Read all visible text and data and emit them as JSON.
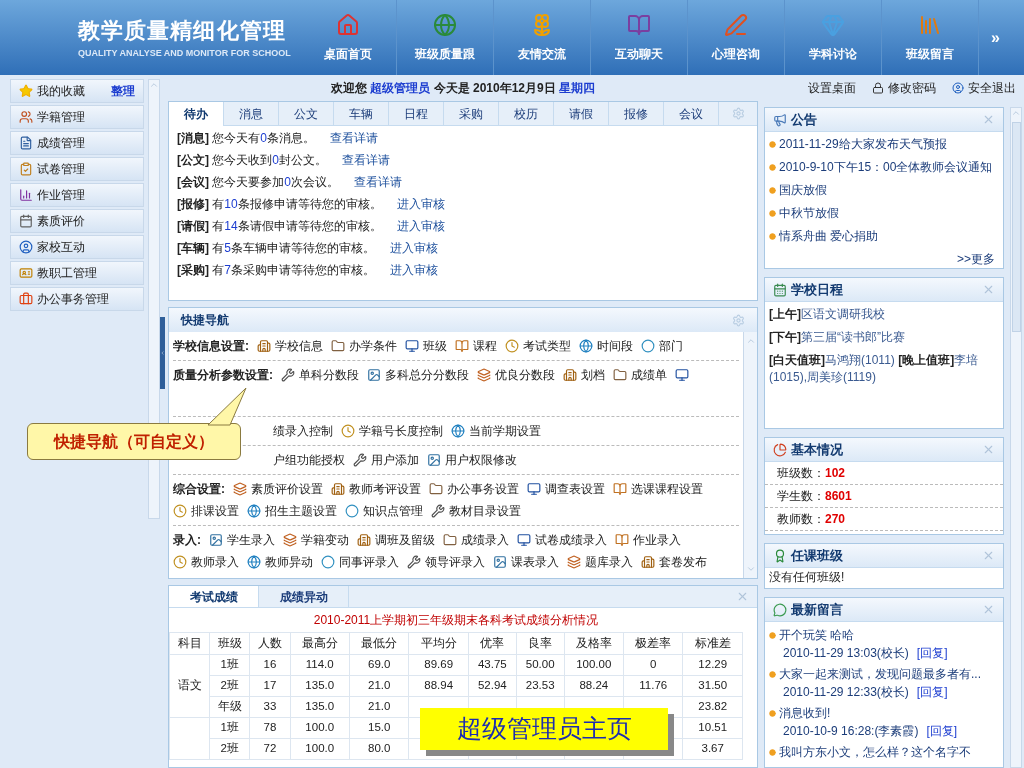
{
  "header": {
    "title": "教学质量精细化管理",
    "subtitle": "QUALITY ANALYSE AND MONITOR FOR SCHOOL",
    "nav": [
      "桌面首页",
      "班级质量跟",
      "友情交流",
      "互动聊天",
      "心理咨询",
      "学科讨论",
      "班级留言"
    ],
    "more": "»"
  },
  "sidebar": {
    "favorites": "我的收藏",
    "manage": "整理",
    "items": [
      "学籍管理",
      "成绩管理",
      "试卷管理",
      "作业管理",
      "素质评价",
      "家校互动",
      "教职工管理",
      "办公事务管理"
    ]
  },
  "welcome": {
    "pre": "欢迎您",
    "user": "超级管理员",
    "mid": "今天是  2010年12月9日",
    "day": "星期四"
  },
  "top_links": [
    "设置桌面",
    "修改密码",
    "安全退出"
  ],
  "todo": {
    "tabs": [
      {
        "label": "待办",
        "selected": true
      },
      {
        "label": "消息",
        "selected": false
      },
      {
        "label": "公文",
        "selected": false
      },
      {
        "label": "车辆",
        "selected": false
      },
      {
        "label": "日程",
        "selected": false
      },
      {
        "label": "采购",
        "selected": false
      },
      {
        "label": "校历",
        "selected": false
      },
      {
        "label": "请假",
        "selected": false
      },
      {
        "label": "报修",
        "selected": false
      },
      {
        "label": "会议",
        "selected": false
      }
    ],
    "lines": [
      {
        "tag": "[消息]",
        "pre": "您今天有",
        "num": "0",
        "post": "条消息。",
        "link": "查看详请"
      },
      {
        "tag": "[公文]",
        "pre": "您今天收到",
        "num": "0",
        "post": "封公文。",
        "link": "查看详请"
      },
      {
        "tag": "[会议]",
        "pre": "您今天要参加",
        "num": "0",
        "post": "次会议。",
        "link": "查看详请"
      },
      {
        "tag": "[报修]",
        "pre": "有",
        "num": "10",
        "post": "条报修申请等待您的审核。",
        "link": "进入审核"
      },
      {
        "tag": "[请假]",
        "pre": "有",
        "num": "14",
        "post": "条请假申请等待您的审核。",
        "link": "进入审核"
      },
      {
        "tag": "[车辆]",
        "pre": "有",
        "num": "5",
        "post": "条车辆申请等待您的审核。",
        "link": "进入审核"
      },
      {
        "tag": "[采购]",
        "pre": "有",
        "num": "7",
        "post": "条采购申请等待您的审核。",
        "link": "进入审核"
      }
    ]
  },
  "quick_nav": {
    "title": "快捷导航",
    "groups": [
      {
        "label": "学校信息设置:",
        "items": [
          {
            "kind": "link",
            "text": "学校信息"
          },
          {
            "kind": "link",
            "text": "办学条件"
          },
          {
            "kind": "link",
            "text": "班级"
          },
          {
            "kind": "link",
            "text": "课程"
          },
          {
            "kind": "link",
            "text": "考试类型"
          },
          {
            "kind": "link",
            "text": "时间段"
          },
          {
            "kind": "link",
            "text": "部门"
          }
        ]
      },
      {
        "label": "质量分析参数设置:",
        "items": [
          {
            "kind": "link",
            "text": "单科分数段"
          },
          {
            "kind": "link",
            "text": "多科总分分数段"
          },
          {
            "kind": "link",
            "text": "优良分数段"
          },
          {
            "kind": "link",
            "text": "划档"
          },
          {
            "kind": "link",
            "text": "成绩单"
          },
          {
            "kind": "icon"
          }
        ]
      },
      {
        "items": [
          {
            "kind": "plain",
            "text": "绩录入控制"
          },
          {
            "kind": "link",
            "text": "学籍号长度控制"
          },
          {
            "kind": "link",
            "text": "当前学期设置"
          }
        ]
      },
      {
        "items": [
          {
            "kind": "plain",
            "text": "户组功能授权"
          },
          {
            "kind": "link",
            "text": "用户添加"
          },
          {
            "kind": "link",
            "text": "用户权限修改"
          }
        ]
      },
      {
        "label": "综合设置:",
        "items": [
          {
            "kind": "link",
            "text": "素质评价设置"
          },
          {
            "kind": "link",
            "text": "教师考评设置"
          },
          {
            "kind": "link",
            "text": "办公事务设置"
          },
          {
            "kind": "link",
            "text": "调查表设置"
          },
          {
            "kind": "link",
            "text": "选课课程设置"
          },
          {
            "kind": "link",
            "text": "排课设置"
          },
          {
            "kind": "link",
            "text": "招生主题设置"
          },
          {
            "kind": "link",
            "text": "知识点管理"
          },
          {
            "kind": "link",
            "text": "教材目录设置"
          }
        ]
      },
      {
        "label": "录入:",
        "items": [
          {
            "kind": "link",
            "text": "学生录入"
          },
          {
            "kind": "link",
            "text": "学籍变动"
          },
          {
            "kind": "link",
            "text": "调班及留级"
          },
          {
            "kind": "link",
            "text": "成绩录入"
          },
          {
            "kind": "link",
            "text": "试卷成绩录入"
          },
          {
            "kind": "link",
            "text": "作业录入"
          },
          {
            "kind": "link",
            "text": "教师录入"
          },
          {
            "kind": "link",
            "text": "教师异动"
          },
          {
            "kind": "link",
            "text": "同事评录入"
          },
          {
            "kind": "link",
            "text": "领导评录入"
          },
          {
            "kind": "link",
            "text": "课表录入"
          },
          {
            "kind": "link",
            "text": "题库录入"
          },
          {
            "kind": "link",
            "text": "套卷发布"
          }
        ]
      }
    ]
  },
  "callout": "快捷导航（可自定义）",
  "scores": {
    "tabs": [
      {
        "label": "考试成绩",
        "selected": true
      },
      {
        "label": "成绩异动",
        "selected": false
      }
    ],
    "title": "2010-2011上学期初三年级期末各科考试成绩分析情况",
    "columns": [
      "科目",
      "班级",
      "人数",
      "最高分",
      "最低分",
      "平均分",
      "优率",
      "良率",
      "及格率",
      "极差率",
      "标准差"
    ],
    "groups": [
      {
        "subject": "语文",
        "rows": [
          [
            "1班",
            "16",
            "114.0",
            "69.0",
            "89.69",
            "43.75",
            "50.00",
            "100.00",
            "0",
            "12.29"
          ],
          [
            "2班",
            "17",
            "135.0",
            "21.0",
            "88.94",
            "52.94",
            "23.53",
            "88.24",
            "11.76",
            "31.50"
          ],
          [
            "年级",
            "33",
            "135.0",
            "21.0",
            null,
            null,
            null,
            null,
            null,
            "23.82"
          ]
        ]
      },
      {
        "rows": [
          [
            "1班",
            "78",
            "100.0",
            "15.0",
            null,
            null,
            null,
            null,
            null,
            "10.51"
          ],
          [
            "2班",
            "72",
            "100.0",
            "80.0",
            null,
            null,
            null,
            null,
            null,
            "3.67"
          ]
        ]
      }
    ]
  },
  "banner": "超级管理员主页",
  "notices": {
    "title": "公告",
    "items": [
      "2011-11-29给大家发布天气预报",
      "2010-9-10下午15：00全体教师会议通知",
      "国庆放假",
      "中秋节放假",
      "情系舟曲 爱心捐助"
    ],
    "more": ">>更多"
  },
  "schedule": {
    "title": "学校日程",
    "entries": [
      [
        {
          "tag": "[上午]",
          "text": "区语文调研我校"
        }
      ],
      [
        {
          "tag": "[下午]",
          "text": "第三届“读书郎”比赛"
        }
      ],
      [
        {
          "tag": "[白天值班]",
          "text": "马鸿翔(1011) "
        },
        {
          "tag": "[晚上值班]",
          "text": "李培(1015),周美珍(1119)"
        }
      ]
    ]
  },
  "basics": {
    "title": "基本情况",
    "rows": [
      {
        "label": "班级数：",
        "value": "102"
      },
      {
        "label": "学生数：",
        "value": "8601"
      },
      {
        "label": "教师数：",
        "value": "270"
      }
    ]
  },
  "classes": {
    "title": "任课班级",
    "text": "没有任何班级!"
  },
  "messages": {
    "title": "最新留言",
    "items": [
      {
        "text": "开个玩笑 哈哈",
        "meta": "2010-11-29 13:03(校长)",
        "reply": "[回复]"
      },
      {
        "text": "大家一起来测试，发现问题最多者有...",
        "meta": "2010-11-29 12:33(校长)",
        "reply": "[回复]"
      },
      {
        "text": "消息收到!",
        "meta": "2010-10-9 16:28:(李素霞)",
        "reply": "[回复]"
      },
      {
        "text": "我叫方东小文，怎么样？这个名字不"
      }
    ]
  }
}
